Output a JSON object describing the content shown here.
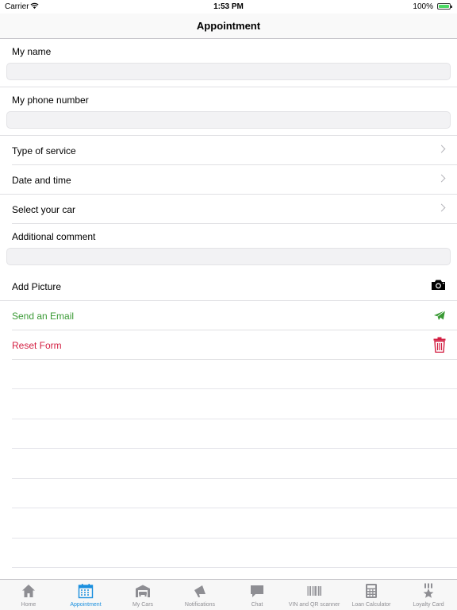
{
  "status_bar": {
    "carrier": "Carrier",
    "time": "1:53 PM",
    "battery": "100%"
  },
  "nav": {
    "title": "Appointment"
  },
  "form": {
    "name_label": "My name",
    "name_value": "",
    "phone_label": "My phone number",
    "phone_value": "",
    "service_label": "Type of service",
    "datetime_label": "Date and time",
    "car_label": "Select your car",
    "comment_label": "Additional comment",
    "comment_value": "",
    "add_picture_label": "Add Picture",
    "send_email_label": "Send an Email",
    "reset_label": "Reset Form"
  },
  "colors": {
    "accent": "#1a8fde",
    "send": "#3a9a35",
    "reset": "#d31f42"
  },
  "tabbar": {
    "active_index": 1,
    "items": [
      {
        "label": "Home",
        "icon": "home-icon"
      },
      {
        "label": "Appointment",
        "icon": "calendar-icon"
      },
      {
        "label": "My Cars",
        "icon": "garage-icon"
      },
      {
        "label": "Notifications",
        "icon": "megaphone-icon"
      },
      {
        "label": "Chat",
        "icon": "chat-bubble-icon"
      },
      {
        "label": "VIN and QR scanner",
        "icon": "barcode-icon"
      },
      {
        "label": "Loan Calculator",
        "icon": "calculator-icon"
      },
      {
        "label": "Loyalty Card",
        "icon": "medal-icon"
      }
    ]
  }
}
